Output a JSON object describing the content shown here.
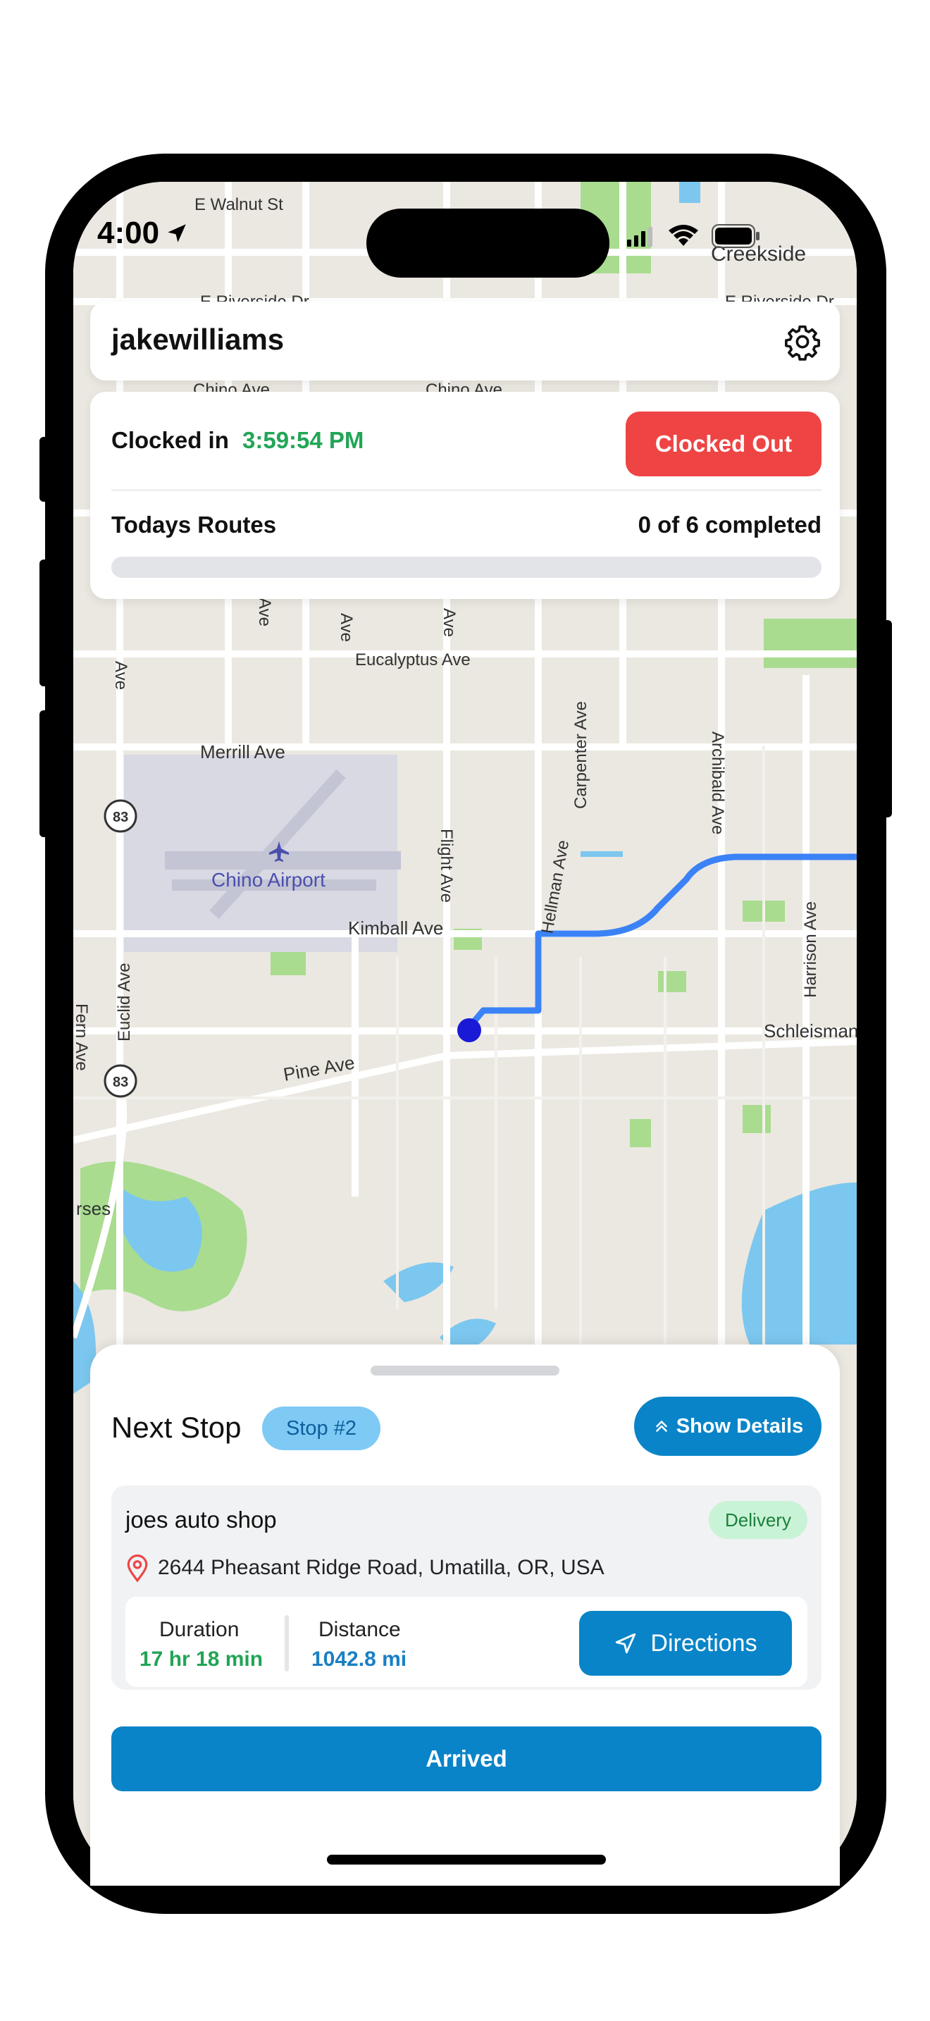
{
  "status_bar": {
    "time": "4:00"
  },
  "header": {
    "username": "jakewilliams"
  },
  "clock": {
    "label": "Clocked in",
    "time": "3:59:54 PM",
    "button_label": "Clocked Out",
    "routes_label": "Todays Routes",
    "routes_count": "0 of 6 completed",
    "routes_progress": 0
  },
  "map": {
    "labels": {
      "walnut": "E Walnut St",
      "creekside": "Creekside",
      "riverside": "E Riverside Dr",
      "riverside_right": "E Riverside Dr",
      "chino_left": "Chino Ave",
      "chino_mid": "Chino Ave",
      "eucalyptus": "Eucalyptus Ave",
      "merrill": "Merrill Ave",
      "carpenter": "Carpenter Ave",
      "archibald": "Archibald Ave",
      "flight": "Flight Ave",
      "hellman": "Hellman Ave",
      "harrison": "Harrison Ave",
      "kimball": "Kimball Ave",
      "euclid": "Euclid Ave",
      "fern": "Fern Ave",
      "pine": "Pine Ave",
      "schleisman": "Schleisman",
      "airport": "Chino Airport",
      "route83_a": "83",
      "route83_b": "83",
      "horses": "rses",
      "ave_a": "Ave",
      "ave_b": "Ave",
      "ave_c": "Ave",
      "ave_d": "Ave"
    }
  },
  "sheet": {
    "title": "Next Stop",
    "stop_badge": "Stop #2",
    "show_details": "Show Details",
    "stop_name": "joes auto shop",
    "stop_type": "Delivery",
    "address": "2644 Pheasant Ridge Road, Umatilla, OR, USA",
    "duration_label": "Duration",
    "duration_value": "17 hr 18 min",
    "distance_label": "Distance",
    "distance_value": "1042.8 mi",
    "directions": "Directions",
    "arrived": "Arrived"
  },
  "colors": {
    "primary": "#0a84c8",
    "danger": "#ef4444",
    "success": "#21a556",
    "route": "#3b82f6"
  }
}
